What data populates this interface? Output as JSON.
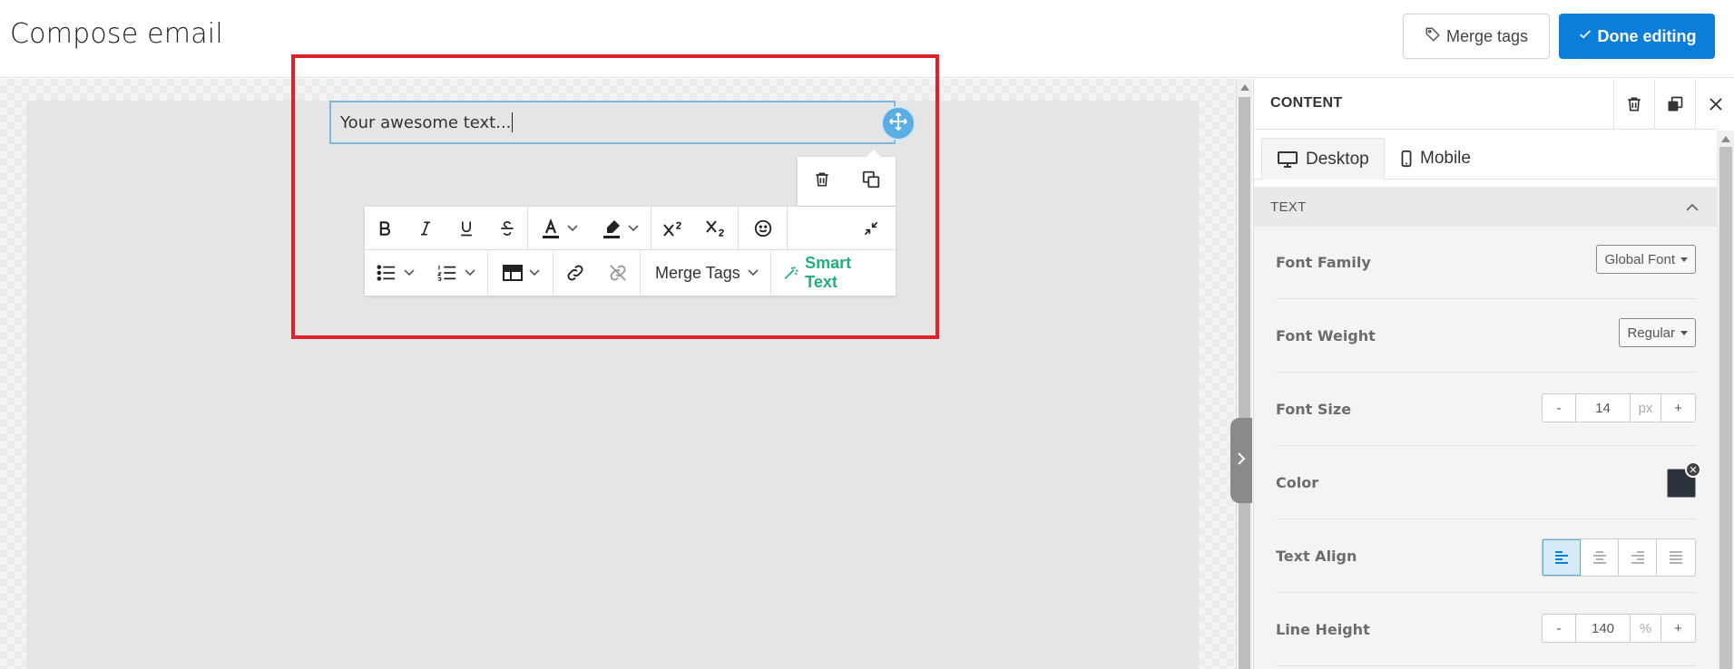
{
  "header": {
    "title": "Compose email",
    "merge_tags_label": "Merge tags",
    "done_label": "Done editing"
  },
  "editor": {
    "text_block_value": "Your awesome text...",
    "toolbar": {
      "merge_tags_label": "Merge Tags",
      "smart_text_label": "Smart Text"
    }
  },
  "panel": {
    "title": "CONTENT",
    "tabs": [
      {
        "label": "Desktop",
        "active": true
      },
      {
        "label": "Mobile",
        "active": false
      }
    ],
    "section": "TEXT",
    "font_family": {
      "label": "Font Family",
      "value": "Global Font"
    },
    "font_weight": {
      "label": "Font Weight",
      "value": "Regular"
    },
    "font_size": {
      "label": "Font Size",
      "value": "14",
      "unit": "px",
      "minus": "-",
      "plus": "+"
    },
    "color": {
      "label": "Color",
      "value": "#2b333e"
    },
    "text_align": {
      "label": "Text Align",
      "value": "left"
    },
    "line_height": {
      "label": "Line Height",
      "value": "140",
      "unit": "%",
      "minus": "-",
      "plus": "+"
    }
  },
  "colors": {
    "accent": "#0b7ed9",
    "highlight_border": "#e0202a",
    "smart_text": "#20b07a",
    "handle": "#5aaee3"
  }
}
